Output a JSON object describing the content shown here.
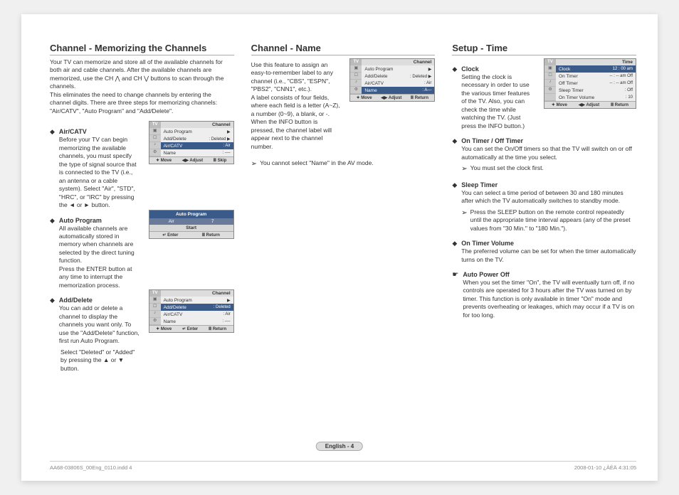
{
  "col1": {
    "heading": "Channel - Memorizing the Channels",
    "intro": "Your TV can memorize and store all of the available channels for both air and cable channels. After the available channels are memorized, use the CH ⋀ and CH ⋁ buttons to scan through the channels.\nThis eliminates the need to change channels by entering the channel digits. There are three steps for memorizing channels: \"Air/CATV\", \"Auto Program\" and \"Add/Delete\".",
    "items": [
      {
        "title": "Air/CATV",
        "text": "Before your TV can begin memorizing the available channels, you must specify the type of signal source that is connected to the TV (i.e., an antenna or a cable system). Select \"Air\", \"STD\", \"HRC\", or \"IRC\" by pressing the ◄ or ► button."
      },
      {
        "title": "Auto Program",
        "text": "All available channels are automatically stored in memory when channels are selected by the direct tuning function.\nPress the ENTER button at any time to interrupt the memorization process."
      },
      {
        "title": "Add/Delete",
        "text": "You can add or delete a channel to display the channels you want only. To use the \"Add/Delete\" function, first run Auto Program.",
        "after": "Select \"Deleted\" or \"Added\" by pressing the ▲ or ▼ button."
      }
    ],
    "osd1": {
      "tv": "TV",
      "title": "Channel",
      "rows": [
        {
          "l": "Auto Program",
          "v": "▶"
        },
        {
          "l": "Add/Delete",
          "v": ": Deleted   ▶"
        },
        {
          "l": "Air/CATV",
          "v": ": Air",
          "hl": true
        },
        {
          "l": "Name",
          "v": ": ----"
        }
      ],
      "foot": [
        "✦ Move",
        "◀▶ Adjust",
        "Ⅲ Skip"
      ]
    },
    "osd2": {
      "head": "Auto Program",
      "mid_l": "Air",
      "mid_r": "7",
      "start": "Start",
      "foot": [
        "↵ Enter",
        "Ⅲ Return"
      ]
    },
    "osd3": {
      "tv": "TV",
      "title": "Channel",
      "rows": [
        {
          "l": "Auto Program",
          "v": "▶"
        },
        {
          "l": "Add/Delete",
          "v": ": Deleted",
          "hl": true
        },
        {
          "l": "Air/CATV",
          "v": ": Air"
        },
        {
          "l": "Name",
          "v": ": ----"
        }
      ],
      "foot": [
        "✦ Move",
        "↵ Enter",
        "Ⅲ Return"
      ]
    }
  },
  "col2": {
    "heading": "Channel - Name",
    "intro": "Use this feature to assign an easy-to-remember label to any channel (i.e., \"CBS\", \"ESPN\", \"PBS2\", \"CNN1\", etc.).\nA label consists of four fields, where each field is a letter (A~Z), a number (0~9), a blank, or -. When the INFO button is pressed, the channel label will appear next to the channel number.",
    "note": "You cannot select \"Name\" in the AV mode.",
    "osd": {
      "tv": "TV",
      "title": "Channel",
      "rows": [
        {
          "l": "Auto Program",
          "v": "▶"
        },
        {
          "l": "Add/Delete",
          "v": ": Deleted   ▶"
        },
        {
          "l": "Air/CATV",
          "v": ": Air"
        },
        {
          "l": "Name",
          "v": ": A---",
          "hl": true
        }
      ],
      "foot": [
        "✦ Move",
        "◀▶ Adjust",
        "Ⅲ Return"
      ]
    }
  },
  "col3": {
    "heading": "Setup - Time",
    "items": [
      {
        "title": "Clock",
        "text": "Setting the clock is necessary in order to use the various timer features of the TV. Also, you can check the time while watching the TV. (Just press the INFO button.)"
      },
      {
        "title": "On Timer / Off Timer",
        "text": "You can set the On/Off timers so that the TV will switch on or off automatically at the time you select.",
        "note": "You must set the clock first."
      },
      {
        "title": "Sleep Timer",
        "text": "You can select a time period of between 30 and 180 minutes after which the TV automatically switches to standby mode.",
        "note": "Press the SLEEP button on the remote control repeatedly until the appropriate time interval appears (any of the preset values from \"30 Min.\" to \"180 Min.\")."
      },
      {
        "title": "On Timer Volume",
        "text": "The preferred volume can be set for when the timer automatically turns on the TV."
      }
    ],
    "auto_off": {
      "title": "Auto Power Off",
      "text": "When you set the timer \"On\", the TV will eventually turn off, if no controls are operated for 3 hours after the TV was turned on by timer. This function is only available in timer \"On\" mode and prevents overheating or leakages, which may occur if a TV is on for too long."
    },
    "osd": {
      "tv": "TV",
      "title": "Time",
      "rows": [
        {
          "l": "Clock",
          "v": "12 : 00 am",
          "hl": true
        },
        {
          "l": "On Timer",
          "v": "-- : --   am  Off"
        },
        {
          "l": "Off Timer",
          "v": "-- : --   am  Off"
        },
        {
          "l": "Sleep Timer",
          "v": ":        Off"
        },
        {
          "l": "On Timer Volume",
          "v": ":        10"
        }
      ],
      "foot": [
        "✦ Move",
        "◀▶ Adjust",
        "Ⅲ Return"
      ]
    }
  },
  "footer": {
    "page": "English - 4",
    "left": "AA68-03806S_00Eng_0110.indd   4",
    "right": "2008-01-10   ¿ÀÈÄ 4:31:05"
  }
}
